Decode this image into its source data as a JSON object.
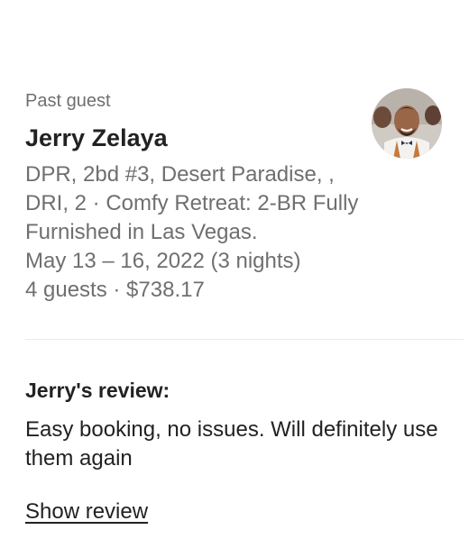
{
  "guest": {
    "status_label": "Past guest",
    "name": "Jerry Zelaya"
  },
  "listing": {
    "lines": [
      "DPR, 2bd #3, Desert Paradise, ,",
      "DRI, 2 · Comfy Retreat: 2-BR Fully",
      "Furnished in Las Vegas."
    ],
    "dates": "May 13 – 16, 2022 (3 nights)",
    "guests_price": "4 guests · $738.17"
  },
  "review": {
    "heading": "Jerry's review:",
    "text": "Easy booking, no issues. Will definitely use them again",
    "show_link": "Show review"
  },
  "icons": {
    "avatar": "guest-avatar-photo"
  }
}
